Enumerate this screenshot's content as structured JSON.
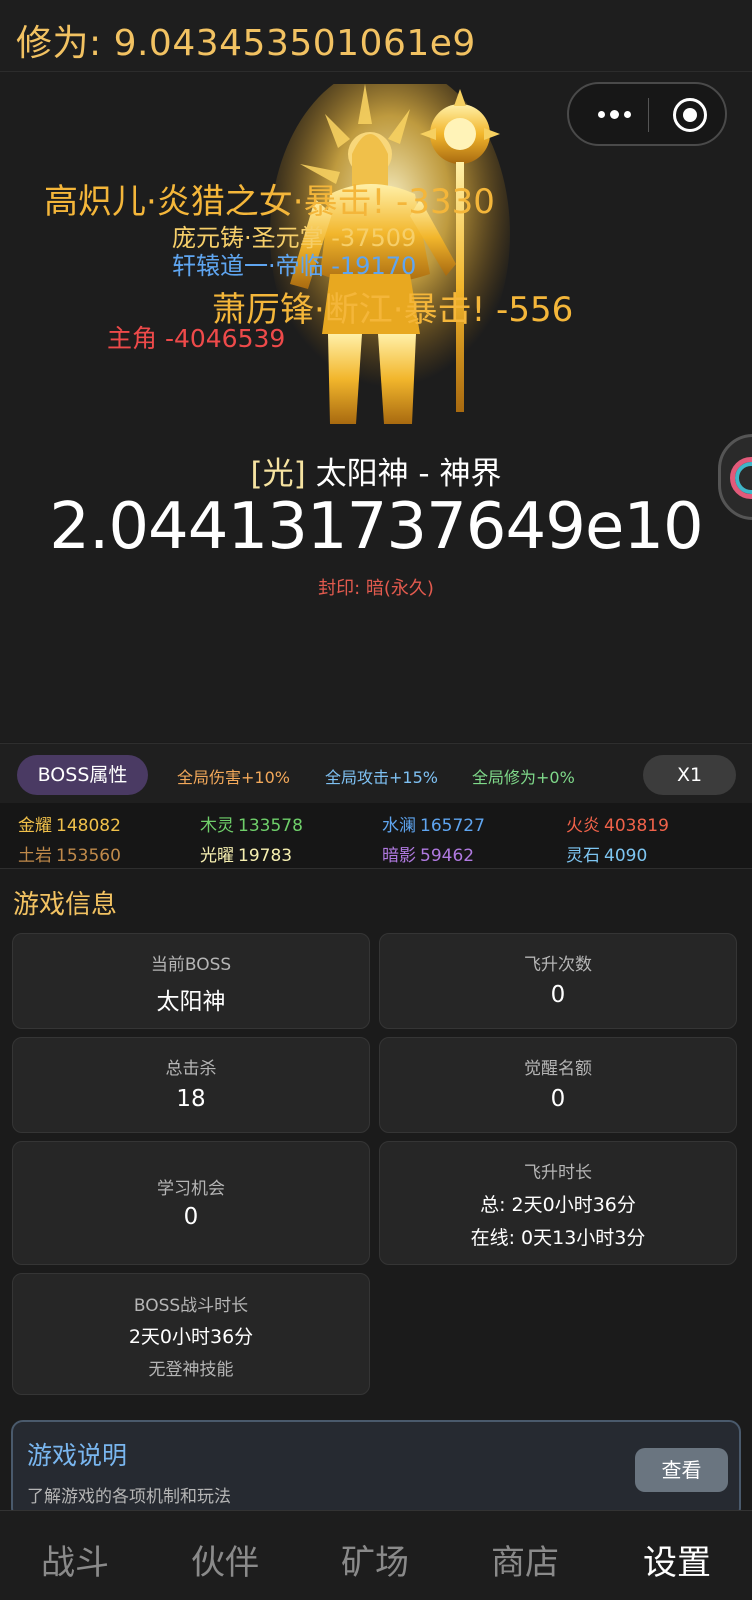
{
  "header": {
    "cultivation_text": "修为: 9.043453501061e9"
  },
  "window_capsule": {
    "more_icon": "more-dots-icon",
    "close_icon": "target-circle-icon"
  },
  "floating_damage": [
    {
      "text": "高炽儿·炎猎之女·暴击! -3330",
      "color": "#f4b63a"
    },
    {
      "text": "庞元铸·圣元掌 -37509",
      "color": "#f6cf6a"
    },
    {
      "text": "轩辕道一·帝临 -19170",
      "color": "#5fa5f0"
    },
    {
      "text": "萧厉锋·断江·暴击! -556",
      "color": "#f4b63a"
    },
    {
      "text": "主角 -4046539",
      "color": "#ee4a4a"
    }
  ],
  "boss": {
    "element_tag": "[光]",
    "name": "太阳神 - 神界",
    "hp": "2.044131737649e10",
    "seal": "封印: 暗(永久)"
  },
  "attr_bar": {
    "boss_attr_label": "BOSS属性",
    "global_damage": "全局伤害+10%",
    "global_attack": "全局攻击+15%",
    "global_cultivation": "全局修为+0%",
    "speed_label": "X1"
  },
  "elements": [
    {
      "name": "金耀",
      "value": "148082",
      "color": "#f0c04a"
    },
    {
      "name": "木灵",
      "value": "133578",
      "color": "#6fcf6a"
    },
    {
      "name": "水澜",
      "value": "165727",
      "color": "#5fa5f0"
    },
    {
      "name": "火炎",
      "value": "403819",
      "color": "#f0624a"
    },
    {
      "name": "土岩",
      "value": "153560",
      "color": "#c08a4a"
    },
    {
      "name": "光曜",
      "value": "19783",
      "color": "#f6efb0"
    },
    {
      "name": "暗影",
      "value": "59462",
      "color": "#b07ae0"
    },
    {
      "name": "灵石",
      "value": "4090",
      "color": "#7ec6f2"
    }
  ],
  "game_info": {
    "title": "游戏信息",
    "current_boss_label": "当前BOSS",
    "current_boss_value": "太阳神",
    "ascend_count_label": "飞升次数",
    "ascend_count_value": "0",
    "total_kills_label": "总击杀",
    "total_kills_value": "18",
    "awaken_quota_label": "觉醒名额",
    "awaken_quota_value": "0",
    "learn_chance_label": "学习机会",
    "learn_chance_value": "0",
    "ascend_time_label": "飞升时长",
    "ascend_time_total": "总: 2天0小时36分",
    "ascend_time_online": "在线: 0天13小时3分",
    "boss_fight_label": "BOSS战斗时长",
    "boss_fight_value": "2天0小时36分",
    "boss_fight_note": "无登神技能"
  },
  "explain": {
    "title": "游戏说明",
    "desc": "了解游戏的各项机制和玩法",
    "button": "查看"
  },
  "tabs": [
    {
      "label": "战斗",
      "active": false
    },
    {
      "label": "伙伴",
      "active": false
    },
    {
      "label": "矿场",
      "active": false
    },
    {
      "label": "商店",
      "active": false
    },
    {
      "label": "设置",
      "active": true
    }
  ]
}
